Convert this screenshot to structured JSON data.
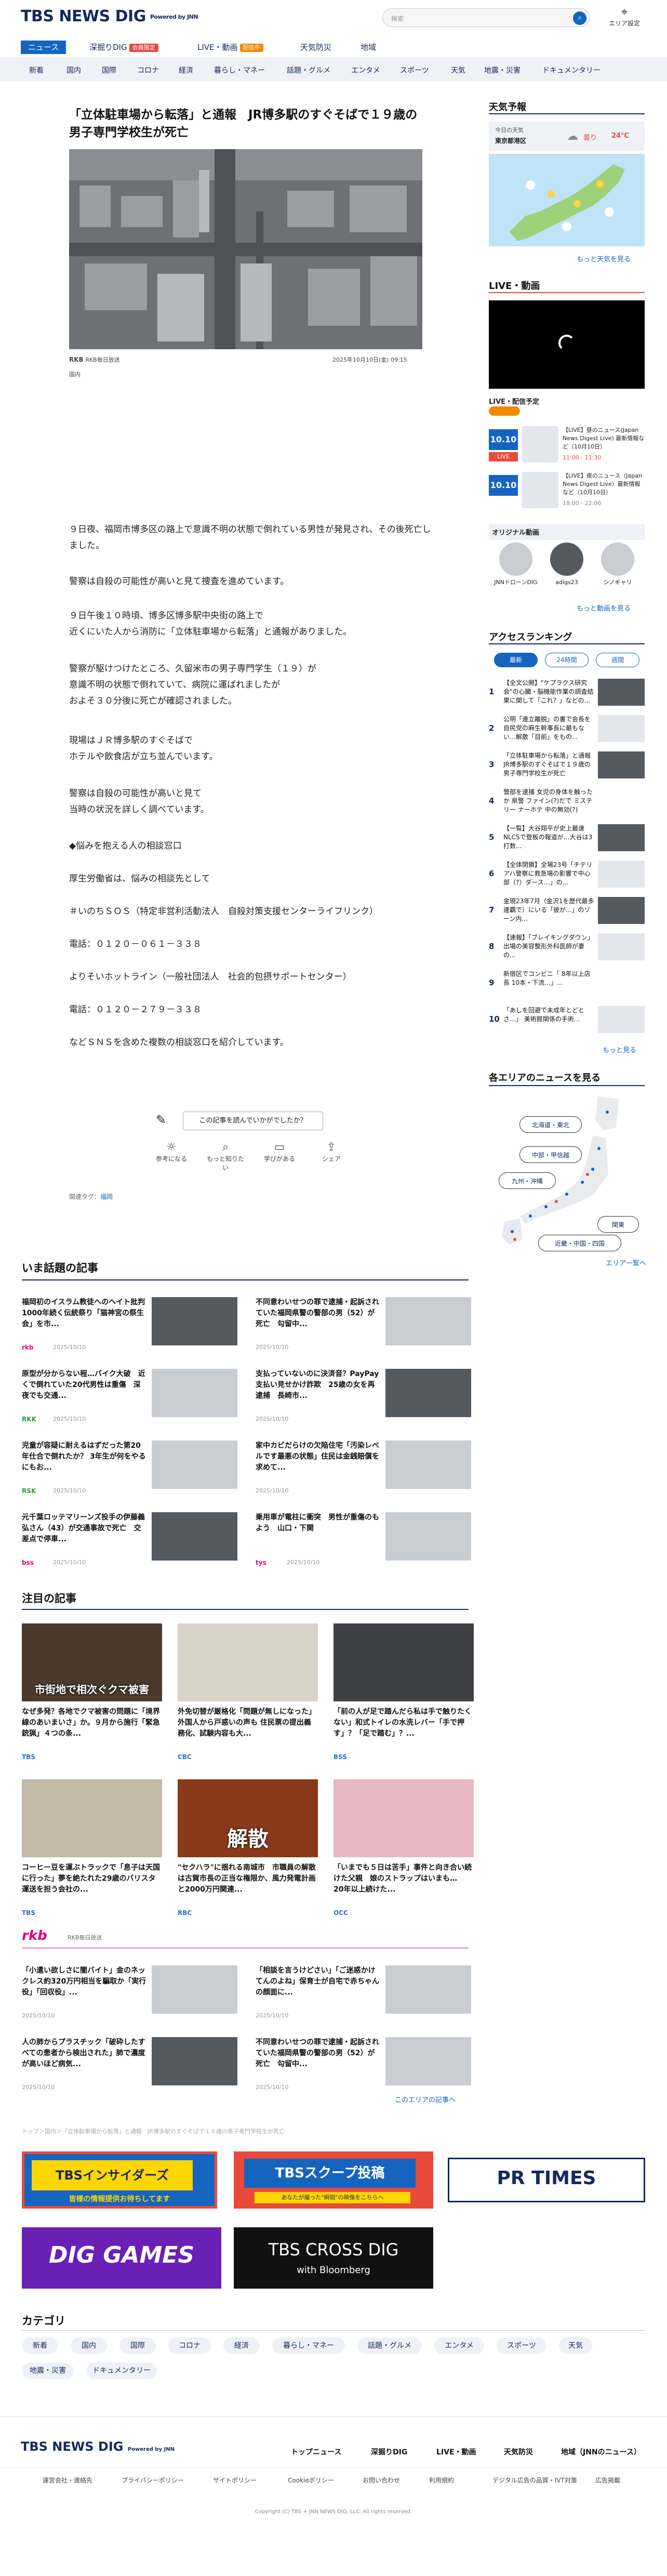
{
  "header": {
    "logo": "TBS NEWS DIG",
    "logo_sub": "Powered by JNN",
    "search_placeholder": "検索",
    "area_label": "エリア設定"
  },
  "nav_primary": [
    {
      "label": "ニュース"
    },
    {
      "label": "深掘りDIG",
      "badge": "会員限定"
    },
    {
      "label": "LIVE・動画",
      "badge": "配信中"
    },
    {
      "label": "天気防災"
    },
    {
      "label": "地域"
    }
  ],
  "nav_secondary": [
    "新着",
    "国内",
    "国際",
    "コロナ",
    "経済",
    "暮らし・マネー",
    "話題・グルメ",
    "エンタメ",
    "スポーツ",
    "天気",
    "地震・災害",
    "ドキュメンタリー"
  ],
  "article": {
    "title": "「立体駐車場から転落」と通報　JR博多駅のすぐそばで１９歳の男子専門学校生が死亡",
    "source": "RKB毎日放送",
    "date": "2025年10月10日(金) 09:15",
    "category": "国内",
    "paragraphs": [
      "９日夜、福岡市博多区の路上で意識不明の状態で倒れている男性が発見され、その後死亡しました。",
      "警察は自殺の可能性が高いと見て捜査を進めています。",
      "９日午後１０時頃、博多区博多駅中央街の路上で\n近くにいた人から消防に「立体駐車場から転落」と通報がありました。",
      "警察が駆けつけたところ、久留米市の男子専門学生（１９）が\n意識不明の状態で倒れていて、病院に運ばれましたが\nおよそ３０分後に死亡が確認されました。",
      "現場はＪＲ博多駅のすぐそばで\nホテルや飲食店が立ち並んでいます。",
      "警察は自殺の可能性が高いと見て\n当時の状況を詳しく調べています。",
      "◆悩みを抱える人の相談窓口",
      "厚生労働省は、悩みの相談先として",
      "＃いのちＳＯＳ（特定非営利活動法人　自殺対策支援センターライフリンク）",
      "電話：０１２０－０６１－３３８",
      "よりそいホットライン（一般社団法人　社会的包摂サポートセンター）",
      "電話：０１２０－２７９－３３８",
      "などＳＮＳを含めた複数の相談窓口を紹介しています。"
    ],
    "feedback_question": "この記事を読んでいかがでしたか？",
    "feedback_options": [
      "参考になる",
      "もっと知りたい",
      "学びがある",
      "シェア"
    ],
    "tag_label": "関連タグ：",
    "tag": "福岡"
  },
  "trending": {
    "heading": "いま話題の記事",
    "items": [
      {
        "title": "福岡初のイスラム教徒へのヘイト批判 1000年続く伝統祭り「猫神宮の祭生会」を市...",
        "date": "2025/10/10",
        "src": "rkb"
      },
      {
        "title": "不同意わいせつの罪で逮捕・起訴されていた福岡県警の警部の男（52）が死亡　勾留中...",
        "date": "2025/10/10",
        "src": ""
      },
      {
        "title": "原型が分からない程…バイク大破　近くで倒れていた20代男性は重傷　深夜でも交通...",
        "date": "2025/10/10",
        "src": "RKK"
      },
      {
        "title": "支払っていないのに決済音？PayPay支払い見せかけ詐欺　25歳の女を再逮捕　長崎市...",
        "date": "2025/10/10",
        "src": ""
      },
      {
        "title": "児童が容疑に耐えるはずだった第20年仕合で倒れたか？ 3年生が何をやるにもお...",
        "date": "2025/10/10",
        "src": "RSK"
      },
      {
        "title": "家中カビだらけの欠陥住宅「汚染レベルです最悪の状態」住民は金銭賠償を求めて...",
        "date": "2025/10/10",
        "src": ""
      },
      {
        "title": "元千葉ロッテマリーンズ投手の伊藤義弘さん（43）が交通事故で死亡　交差点で停車...",
        "date": "2025/10/10",
        "src": "bss"
      },
      {
        "title": "乗用車が電柱に衝突　男性が重傷のもよう　山口・下関",
        "date": "2025/10/10",
        "src": "tys"
      }
    ]
  },
  "featured": {
    "heading": "注目の記事",
    "items": [
      {
        "title": "なぜ多発？各地でクマ被害の問題に「境界線のあいまいさ」か。９月から施行「緊急銃猟」４つの条...",
        "src": "TBS",
        "overlay": "市街地で相次ぐクマ被害"
      },
      {
        "title": "外免切替が厳格化「問題が無しになった」外国人から戸惑いの声も 住民票の提出義務化、試験内容も大...",
        "src": "CBC",
        "overlay": ""
      },
      {
        "title": "「前の人が足で踏んだら私は手で触りたくない」和式トイレの水洗レバー「手で押す」？「足で踏む」？...",
        "src": "BSS",
        "overlay": ""
      },
      {
        "title": "コーヒー豆を運ぶトラックで「息子は天国に行った」夢を絶たれた29歳のバリスタ　運送を担う会社の...",
        "src": "TBS",
        "overlay": ""
      },
      {
        "title": "\"セクハラ\"に揺れる南城市　市職員の解散は古賀市長の正当な権限か、風力発電計画と2000万円関連...",
        "src": "RBC",
        "overlay": "解散"
      },
      {
        "title": "「いまでも５日は苦手」事件と向き合い続けた父親　娘のストラップはいまも…　20年以上続けた...",
        "src": "OCC",
        "overlay": ""
      }
    ]
  },
  "local": {
    "logo": "rkb",
    "heading": "RKB毎日放送",
    "items": [
      {
        "title": "「小遣い欲しさに闇バイト」金のネックレス約320万円相当を騙取か「実行役」「回収役」...",
        "date": "2025/10/10"
      },
      {
        "title": "「相談を言うけどさい」「ご迷惑かけてんのよね」保育士が自宅で赤ちゃんの顔面に...",
        "date": "2025/10/10"
      },
      {
        "title": "人の肺からプラスチック「破砕したすべての患者から検出された」肺で濃度が高いほど病気...",
        "date": "2025/10/10"
      },
      {
        "title": "不同意わいせつの罪で逮捕・起訴されていた福岡県警の警部の男（52）が死亡　勾留中...",
        "date": "2025/10/10"
      }
    ],
    "more": "このエリアの記事へ"
  },
  "breadcrumb": "トップ＞国内＞「立体駐車場から転落」と通報　JR博多駅のすぐそばで１９歳の男子専門学校生が死亡",
  "banners": [
    {
      "title": "TBSインサイダーズ",
      "sub": "皆様の情報提供お待ちしてます"
    },
    {
      "title": "TBSスクープ投稿",
      "sub": "あなたが撮った\"瞬間\"の映像をこちらへ"
    },
    {
      "title": "PR TIMES",
      "sub": ""
    },
    {
      "title": "DIG GAMES",
      "sub": ""
    },
    {
      "title": "TBS CROSS DIG",
      "sub": "with Bloomberg"
    }
  ],
  "categories": {
    "heading": "カテゴリ",
    "items": [
      "新着",
      "国内",
      "国際",
      "コロナ",
      "経済",
      "暮らし・マネー",
      "話題・グルメ",
      "エンタメ",
      "スポーツ",
      "天気",
      "地震・災害",
      "ドキュメンタリー"
    ]
  },
  "sidebar": {
    "weather": {
      "heading": "天気予報",
      "today_label": "今日の天気",
      "place": "東京都港区",
      "forecast": "曇り",
      "temp": "24℃",
      "more": "もっと天気を見る"
    },
    "live": {
      "heading": "LIVE・動画",
      "schedule_heading": "LIVE・配信予定",
      "items": [
        {
          "date": "10.10",
          "badge": "LIVE",
          "title": "【LIVE】昼のニュース(Japan News Digest Live) 最新情報など（10月10日）",
          "time": "11:00 - 11:30"
        },
        {
          "date": "10.10",
          "badge": "",
          "title": "【LIVE】夜のニュース（Japan News Digest Live）最新情報など（10月10日）",
          "time": "18:00 - 22:00"
        }
      ],
      "original_heading": "オリジナル動画",
      "originals": [
        "JNNドローンDIG",
        "adigs23",
        "シノギャリ"
      ],
      "more": "もっと動画を見る"
    },
    "ranking": {
      "heading": "アクセスランキング",
      "tabs": [
        "最新",
        "24時間",
        "週間"
      ],
      "items": [
        {
          "n": "1",
          "title": "【全文公開】\"ケプラクス研究会\"の心臓・脳機能作業の調査結果に関して「これ？」などの...",
          "img": "d"
        },
        {
          "n": "2",
          "title": "公明「連立離脱」の裏で会長を自民党の麻生幹事長に最もない…解散「目前」をもの...",
          "img": "l"
        },
        {
          "n": "3",
          "title": "「立体駐車場から転落」と通報 JR博多駅のすぐそばで１９歳の男子専門学校生が死亡",
          "img": "d"
        },
        {
          "n": "4",
          "title": "警部を逮捕 女児の身体を触ったか 県警 ファイン(?)だで ミステリー ナーホテ 中の無効(?)",
          "img": ""
        },
        {
          "n": "5",
          "title": "【一覧】大谷翔平が史上最速NLCSで登板の報道が…大谷は3打数...",
          "img": "d"
        },
        {
          "n": "6",
          "title": "【全体閉鎖】全場23号「チテリアハ警察に救急場の影響で中心部（?）ダース…」の...",
          "img": "l"
        },
        {
          "n": "7",
          "title": "金現23年7月（金沢1を歴代最多連覇で）にいる「彼が...」のゾーン内...",
          "img": "d"
        },
        {
          "n": "8",
          "title": "【速報】「ブレイキングダウン」出場の美容整形外科医師が妻の...",
          "img": "l"
        },
        {
          "n": "9",
          "title": "新宿区でコンビニ「 8年以上店長 10本・下流…」...",
          "img": ""
        },
        {
          "n": "10",
          "title": "「あしを回避で未成年とどとさ…」 美術館関係の手術...",
          "img": "l"
        }
      ],
      "more": "もっと見る"
    },
    "areas": {
      "heading": "各エリアのニュースを見る",
      "items": [
        "北海道・東北",
        "中部・甲信越",
        "九州・沖縄",
        "関東",
        "近畿・中国・四国"
      ],
      "more": "エリア一覧へ"
    }
  },
  "footer": {
    "logo": "TBS NEWS DIG",
    "logo_sub": "Powered by JNN",
    "nav": [
      "トップニュース",
      "深掘りDIG",
      "LIVE・動画",
      "天気防災",
      "地域（JNNのニュース）"
    ],
    "links": [
      "運営会社・連絡先",
      "プライバシーポリシー",
      "サイトポリシー",
      "Cookieポリシー",
      "お問い合わせ",
      "利用規約",
      "デジタル広告の品質・IVT対策",
      "広告掲載"
    ],
    "copyright": "Copyright (C) TBS + JNN NEWS DIG, LLC. All rights reserved."
  }
}
